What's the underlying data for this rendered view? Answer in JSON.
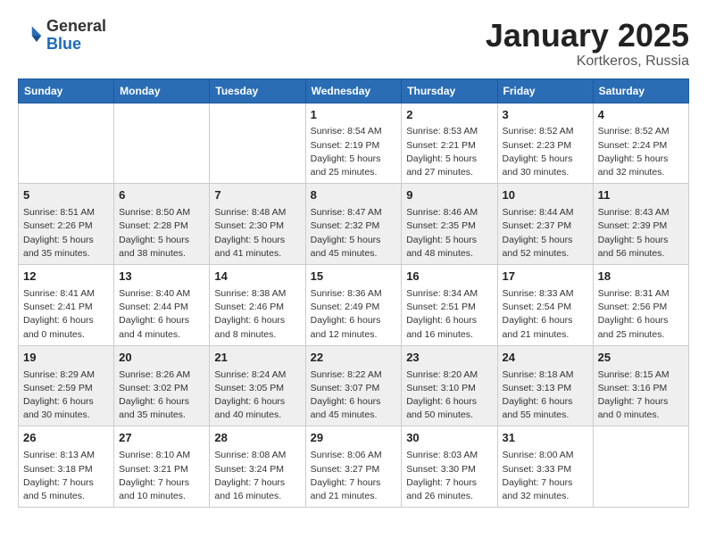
{
  "header": {
    "logo_general": "General",
    "logo_blue": "Blue",
    "month_title": "January 2025",
    "location": "Kortkeros, Russia"
  },
  "weekdays": [
    "Sunday",
    "Monday",
    "Tuesday",
    "Wednesday",
    "Thursday",
    "Friday",
    "Saturday"
  ],
  "weeks": [
    [
      {
        "day": "",
        "info": ""
      },
      {
        "day": "",
        "info": ""
      },
      {
        "day": "",
        "info": ""
      },
      {
        "day": "1",
        "info": "Sunrise: 8:54 AM\nSunset: 2:19 PM\nDaylight: 5 hours\nand 25 minutes."
      },
      {
        "day": "2",
        "info": "Sunrise: 8:53 AM\nSunset: 2:21 PM\nDaylight: 5 hours\nand 27 minutes."
      },
      {
        "day": "3",
        "info": "Sunrise: 8:52 AM\nSunset: 2:23 PM\nDaylight: 5 hours\nand 30 minutes."
      },
      {
        "day": "4",
        "info": "Sunrise: 8:52 AM\nSunset: 2:24 PM\nDaylight: 5 hours\nand 32 minutes."
      }
    ],
    [
      {
        "day": "5",
        "info": "Sunrise: 8:51 AM\nSunset: 2:26 PM\nDaylight: 5 hours\nand 35 minutes."
      },
      {
        "day": "6",
        "info": "Sunrise: 8:50 AM\nSunset: 2:28 PM\nDaylight: 5 hours\nand 38 minutes."
      },
      {
        "day": "7",
        "info": "Sunrise: 8:48 AM\nSunset: 2:30 PM\nDaylight: 5 hours\nand 41 minutes."
      },
      {
        "day": "8",
        "info": "Sunrise: 8:47 AM\nSunset: 2:32 PM\nDaylight: 5 hours\nand 45 minutes."
      },
      {
        "day": "9",
        "info": "Sunrise: 8:46 AM\nSunset: 2:35 PM\nDaylight: 5 hours\nand 48 minutes."
      },
      {
        "day": "10",
        "info": "Sunrise: 8:44 AM\nSunset: 2:37 PM\nDaylight: 5 hours\nand 52 minutes."
      },
      {
        "day": "11",
        "info": "Sunrise: 8:43 AM\nSunset: 2:39 PM\nDaylight: 5 hours\nand 56 minutes."
      }
    ],
    [
      {
        "day": "12",
        "info": "Sunrise: 8:41 AM\nSunset: 2:41 PM\nDaylight: 6 hours\nand 0 minutes."
      },
      {
        "day": "13",
        "info": "Sunrise: 8:40 AM\nSunset: 2:44 PM\nDaylight: 6 hours\nand 4 minutes."
      },
      {
        "day": "14",
        "info": "Sunrise: 8:38 AM\nSunset: 2:46 PM\nDaylight: 6 hours\nand 8 minutes."
      },
      {
        "day": "15",
        "info": "Sunrise: 8:36 AM\nSunset: 2:49 PM\nDaylight: 6 hours\nand 12 minutes."
      },
      {
        "day": "16",
        "info": "Sunrise: 8:34 AM\nSunset: 2:51 PM\nDaylight: 6 hours\nand 16 minutes."
      },
      {
        "day": "17",
        "info": "Sunrise: 8:33 AM\nSunset: 2:54 PM\nDaylight: 6 hours\nand 21 minutes."
      },
      {
        "day": "18",
        "info": "Sunrise: 8:31 AM\nSunset: 2:56 PM\nDaylight: 6 hours\nand 25 minutes."
      }
    ],
    [
      {
        "day": "19",
        "info": "Sunrise: 8:29 AM\nSunset: 2:59 PM\nDaylight: 6 hours\nand 30 minutes."
      },
      {
        "day": "20",
        "info": "Sunrise: 8:26 AM\nSunset: 3:02 PM\nDaylight: 6 hours\nand 35 minutes."
      },
      {
        "day": "21",
        "info": "Sunrise: 8:24 AM\nSunset: 3:05 PM\nDaylight: 6 hours\nand 40 minutes."
      },
      {
        "day": "22",
        "info": "Sunrise: 8:22 AM\nSunset: 3:07 PM\nDaylight: 6 hours\nand 45 minutes."
      },
      {
        "day": "23",
        "info": "Sunrise: 8:20 AM\nSunset: 3:10 PM\nDaylight: 6 hours\nand 50 minutes."
      },
      {
        "day": "24",
        "info": "Sunrise: 8:18 AM\nSunset: 3:13 PM\nDaylight: 6 hours\nand 55 minutes."
      },
      {
        "day": "25",
        "info": "Sunrise: 8:15 AM\nSunset: 3:16 PM\nDaylight: 7 hours\nand 0 minutes."
      }
    ],
    [
      {
        "day": "26",
        "info": "Sunrise: 8:13 AM\nSunset: 3:18 PM\nDaylight: 7 hours\nand 5 minutes."
      },
      {
        "day": "27",
        "info": "Sunrise: 8:10 AM\nSunset: 3:21 PM\nDaylight: 7 hours\nand 10 minutes."
      },
      {
        "day": "28",
        "info": "Sunrise: 8:08 AM\nSunset: 3:24 PM\nDaylight: 7 hours\nand 16 minutes."
      },
      {
        "day": "29",
        "info": "Sunrise: 8:06 AM\nSunset: 3:27 PM\nDaylight: 7 hours\nand 21 minutes."
      },
      {
        "day": "30",
        "info": "Sunrise: 8:03 AM\nSunset: 3:30 PM\nDaylight: 7 hours\nand 26 minutes."
      },
      {
        "day": "31",
        "info": "Sunrise: 8:00 AM\nSunset: 3:33 PM\nDaylight: 7 hours\nand 32 minutes."
      },
      {
        "day": "",
        "info": ""
      }
    ]
  ]
}
